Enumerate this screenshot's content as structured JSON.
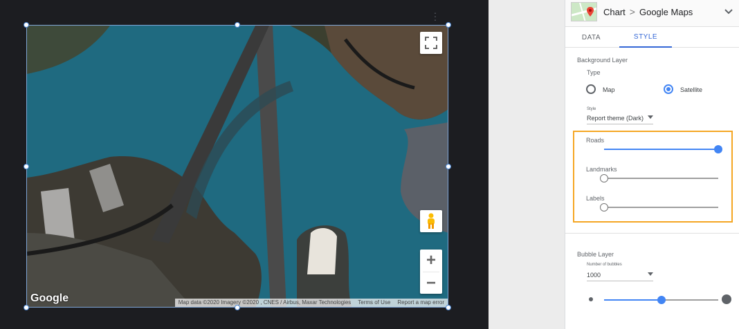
{
  "panel": {
    "breadcrumb": {
      "parent": "Chart",
      "separator": ">",
      "current": "Google Maps"
    },
    "tabs": [
      {
        "label": "DATA",
        "active": false
      },
      {
        "label": "STYLE",
        "active": true
      }
    ],
    "background_layer": {
      "title": "Background Layer",
      "type_label": "Type",
      "type_options": [
        {
          "label": "Map",
          "selected": false
        },
        {
          "label": "Satellite",
          "selected": true
        }
      ],
      "style_label": "Style",
      "style_value": "Report theme (Dark)",
      "sliders": [
        {
          "label": "Roads",
          "value": 1.0
        },
        {
          "label": "Landmarks",
          "value": 0.0
        },
        {
          "label": "Labels",
          "value": 0.0
        }
      ]
    },
    "bubble_layer": {
      "title": "Bubble Layer",
      "count_label": "Number of bubbles",
      "count_value": "1000",
      "size_slider_value": 0.5
    }
  },
  "map": {
    "logo": "Google",
    "attribution": [
      "Map data ©2020 Imagery ©2020 , CNES / Airbus, Maxar Technologies",
      "Terms of Use",
      "Report a map error"
    ],
    "controls": {
      "fullscreen_icon": "fullscreen-icon",
      "pegman_icon": "pegman-icon",
      "zoom_in": "+",
      "zoom_out": "−"
    }
  },
  "colors": {
    "accent": "#4285f4",
    "highlight": "#f5a623",
    "canvas": "#1c1d21",
    "water": "#1f6a80"
  }
}
